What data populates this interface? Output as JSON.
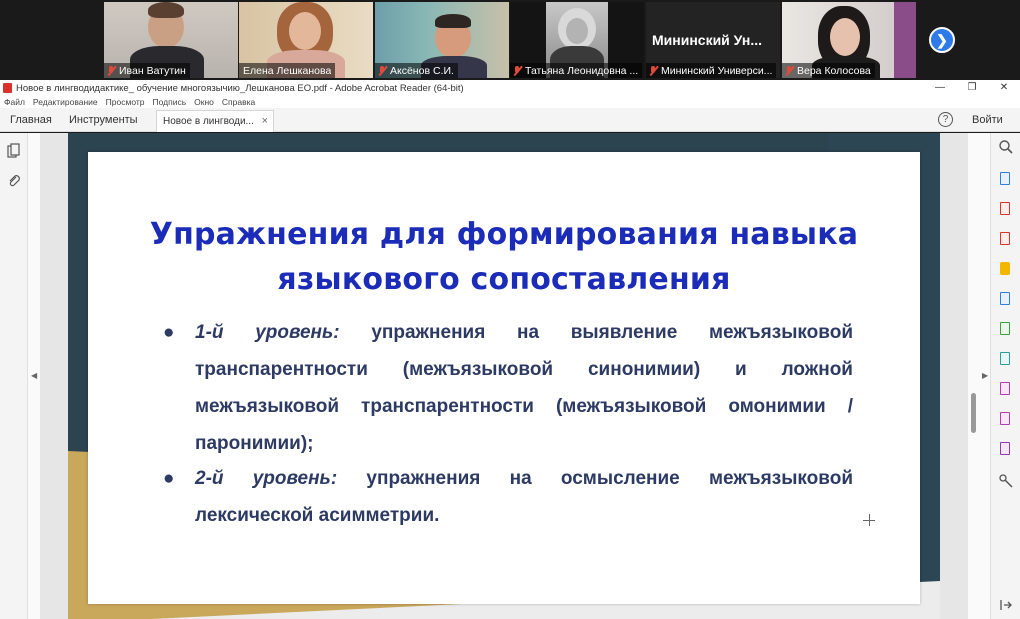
{
  "meeting": {
    "participants": [
      {
        "name": "Иван Ватутин",
        "muted": true
      },
      {
        "name": "Елена Лешканова",
        "muted": false
      },
      {
        "name": "Аксёнов С.И.",
        "muted": true
      },
      {
        "name": "Татьяна  Леонидовна ...",
        "muted": true
      },
      {
        "name": "Мининский Универси...",
        "muted": true,
        "big_label": "Мининский  Ун..."
      },
      {
        "name": "Вера Колосова",
        "muted": true
      }
    ],
    "next_arrow": "❯"
  },
  "window": {
    "title": "Новое в лингводидактике_ обучение многоязычию_Лешканова ЕО.pdf - Adobe Acrobat Reader (64-bit)",
    "minimize": "—",
    "maximize": "❐",
    "close": "✕"
  },
  "menu": [
    "Файл",
    "Редактирование",
    "Просмотр",
    "Подпись",
    "Окно",
    "Справка"
  ],
  "tabs": {
    "home": "Главная",
    "tools": "Инструменты",
    "document": "Новое в лингводи...",
    "close": "×",
    "help": "?",
    "sign_in": "Войти"
  },
  "slide": {
    "title_line1": "Упражнения для формирования навыка",
    "title_line2": "языкового сопоставления",
    "bullets": [
      {
        "level": "1-й уровень:",
        "text": " упражнения на выявление межъязыковой транспарентности (межъязыковой синонимии) и ложной межъязыковой транспарентности (межъязыковой омонимии / паронимии);"
      },
      {
        "level": "2-й уровень:",
        "text": " упражнения на осмысление межъязыковой лексической асимметрии."
      }
    ],
    "bullet_symbol": "●"
  },
  "colors": {
    "title_blue": "#1b2db8",
    "body_text": "#2d3a63",
    "slide_dark": "#2c4350",
    "slide_gold": "#c9a75b",
    "zoom_accent": "#2d7ae8"
  }
}
